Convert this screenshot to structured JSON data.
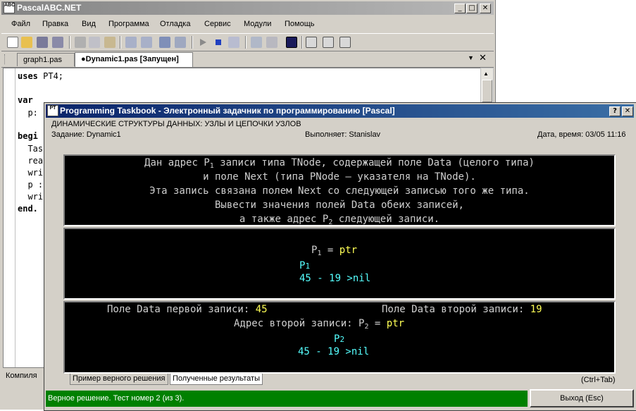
{
  "ide": {
    "title": "PascalABC.NET",
    "icon_text": "ABC",
    "window_buttons": {
      "minimize": "_",
      "maximize": "□",
      "close": "✕"
    },
    "menu": [
      "Файл",
      "Правка",
      "Вид",
      "Программа",
      "Отладка",
      "Сервис",
      "Модули",
      "Помощь"
    ],
    "toolbar_icons": [
      "new-file-icon",
      "open-folder-icon",
      "save-icon",
      "save-all-icon",
      "cut-icon",
      "copy-icon",
      "paste-icon",
      "undo-icon",
      "redo-icon",
      "step-in-icon",
      "step-over-icon",
      "run-icon",
      "stop-icon",
      "step-icon",
      "step2-icon",
      "console-icon",
      "window1-icon",
      "window2-icon",
      "window3-icon"
    ],
    "tabs": [
      {
        "label": "graph1.pas"
      },
      {
        "label": "●Dynamic1.pas [Запущен]"
      }
    ],
    "tab_controls": {
      "dropdown": "▼",
      "close": "✕"
    },
    "code_lines": [
      {
        "text": "uses PT4;",
        "bold_prefix": "uses"
      },
      {
        "text": "",
        "bold_prefix": ""
      },
      {
        "text": "var",
        "bold_prefix": "var"
      },
      {
        "text": "  p:",
        "bold_prefix": ""
      },
      {
        "text": "",
        "bold_prefix": ""
      },
      {
        "text": "begi",
        "bold_prefix": "begi"
      },
      {
        "text": "  Tas",
        "bold_prefix": ""
      },
      {
        "text": "  rea",
        "bold_prefix": ""
      },
      {
        "text": "  wri",
        "bold_prefix": ""
      },
      {
        "text": "  p :",
        "bold_prefix": ""
      },
      {
        "text": "  wri",
        "bold_prefix": ""
      },
      {
        "text": "end.",
        "bold_prefix": "end."
      }
    ],
    "statusbar_label": "Компиля"
  },
  "taskbook": {
    "icon_text": "PT",
    "title": "Programming Taskbook - Электронный задачник по программированию [Pascal]",
    "window_buttons": {
      "help": "?",
      "close": "✕"
    },
    "header": {
      "topic": "ДИНАМИЧЕСКИЕ СТРУКТУРЫ ДАННЫХ: УЗЛЫ И ЦЕПОЧКИ УЗЛОВ",
      "task": "Задание: Dynamic1",
      "performer": "Выполняет: Stanislav",
      "datetime": "Дата, время: 03/05 11:16"
    },
    "task_text": {
      "l1a": "Дан адрес P",
      "l1s": "1",
      "l1b": " записи типа TNode, содержащей поле Data (целого типа)",
      "l2": "и поле Next (типа PNode — указателя на TNode).",
      "l3": "Эта запись связана полем Next со следующей записью того же типа.",
      "l4": "Вывести значения полей Data обеих записей,",
      "l5a": "а также адрес P",
      "l5s": "2",
      "l5b": " следующей записи."
    },
    "input_data": {
      "p_name": "P",
      "p_sub": "1",
      "eq": " = ",
      "p_value": "ptr",
      "node_label": "P",
      "node_sub": "1",
      "chain": "45 - 19 >nil"
    },
    "output_data": {
      "first_label": "Поле Data первой записи: ",
      "first_value": "45",
      "second_label": "Поле Data второй записи: ",
      "second_value": "19",
      "addr_label": "Адрес второй записи: P",
      "addr_sub": "2",
      "addr_eq": " = ",
      "addr_value": "ptr",
      "node_label": "P",
      "node_sub": "2",
      "chain": "45 - 19 >nil"
    },
    "bottom_tabs": [
      "Пример верного решения",
      "Полученные результаты"
    ],
    "hotkey_hint": "(Ctrl+Tab)",
    "status": "Верное решение. Тест номер 2 (из 3).",
    "exit_button": "Выход (Esc)"
  }
}
